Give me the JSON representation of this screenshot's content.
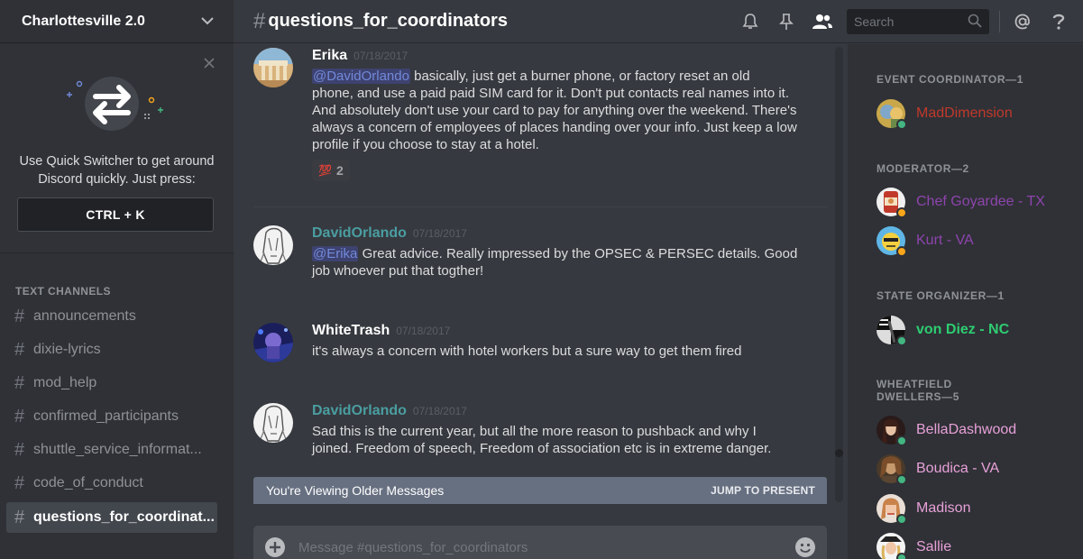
{
  "server": {
    "name": "Charlottesville 2.0"
  },
  "quick_switcher": {
    "line1": "Use Quick Switcher to get around",
    "line2": "Discord quickly. Just press:",
    "shortcut": "CTRL + K"
  },
  "channels": {
    "category": "TEXT CHANNELS",
    "items": [
      {
        "name": "announcements"
      },
      {
        "name": "dixie-lyrics"
      },
      {
        "name": "mod_help"
      },
      {
        "name": "confirmed_participants"
      },
      {
        "name": "shuttle_service_informat..."
      },
      {
        "name": "code_of_conduct"
      },
      {
        "name": "questions_for_coordinat..."
      }
    ]
  },
  "topbar": {
    "hash": "#",
    "channel_title": "questions_for_coordinators",
    "search_placeholder": "Search"
  },
  "messages": [
    {
      "author": "Erika",
      "timestamp": "07/18/2017",
      "mention": "@DavidOrlando",
      "lines": [
        " basically, just get a burner phone, or factory reset an old",
        "phone, and use a paid paid SIM card for it. Don't put contacts real names into it.",
        "And absolutely don't use your card to pay for anything over the weekend. There's",
        "always a concern of employees of places handing over your info. Just keep a low",
        "profile if you choose to stay at a hotel."
      ],
      "reaction": {
        "emoji": "💯",
        "count": "2"
      }
    },
    {
      "author": "DavidOrlando",
      "timestamp": "07/18/2017",
      "mention": "@Erika",
      "lines": [
        " Great advice. Really impressed by the OPSEC & PERSEC details. Good",
        "job whoever put that togther!"
      ]
    },
    {
      "author": "WhiteTrash",
      "timestamp": "07/18/2017",
      "lines": [
        "it's always a concern with hotel workers but a sure way to get them fired"
      ]
    },
    {
      "author": "DavidOrlando",
      "timestamp": "07/18/2017",
      "lines": [
        "Sad this is the current year, but all the more reason to pushback and why I",
        "joined. Freedom of speech, Freedom of association etc is in extreme danger."
      ]
    }
  ],
  "older_bar": {
    "label": "You're Viewing Older Messages",
    "jump": "JUMP TO PRESENT"
  },
  "composer": {
    "placeholder": "Message #questions_for_coordinators"
  },
  "members": {
    "groups": [
      {
        "title": "EVENT COORDINATOR—1",
        "members": [
          {
            "name": "MadDimension",
            "color": "#c0392b",
            "status": "online"
          }
        ]
      },
      {
        "title": "MODERATOR—2",
        "members": [
          {
            "name": "Chef Goyardee - TX",
            "color": "#8e44ad",
            "status": "idle"
          },
          {
            "name": "Kurt - VA",
            "color": "#8e44ad",
            "status": "idle"
          }
        ]
      },
      {
        "title": "STATE ORGANIZER—1",
        "members": [
          {
            "name": "von Diez - NC",
            "color": "#2ecc71",
            "status": "online"
          }
        ]
      },
      {
        "title_line1": "WHEATFIELD",
        "title_line2": "DWELLERS—5",
        "members": [
          {
            "name": "BellaDashwood",
            "color": "#e8a0d8",
            "status": "online"
          },
          {
            "name": "Boudica - VA",
            "color": "#e8a0d8",
            "status": "online"
          },
          {
            "name": "Madison",
            "color": "#e8a0d8",
            "status": "online"
          },
          {
            "name": "Sallie",
            "color": "#e8a0d8",
            "status": "online"
          }
        ]
      }
    ]
  },
  "colors": {
    "online": "#43b581",
    "idle": "#faa61a",
    "mention_text": "#7289da",
    "author_teal": "#4a9ea1"
  }
}
